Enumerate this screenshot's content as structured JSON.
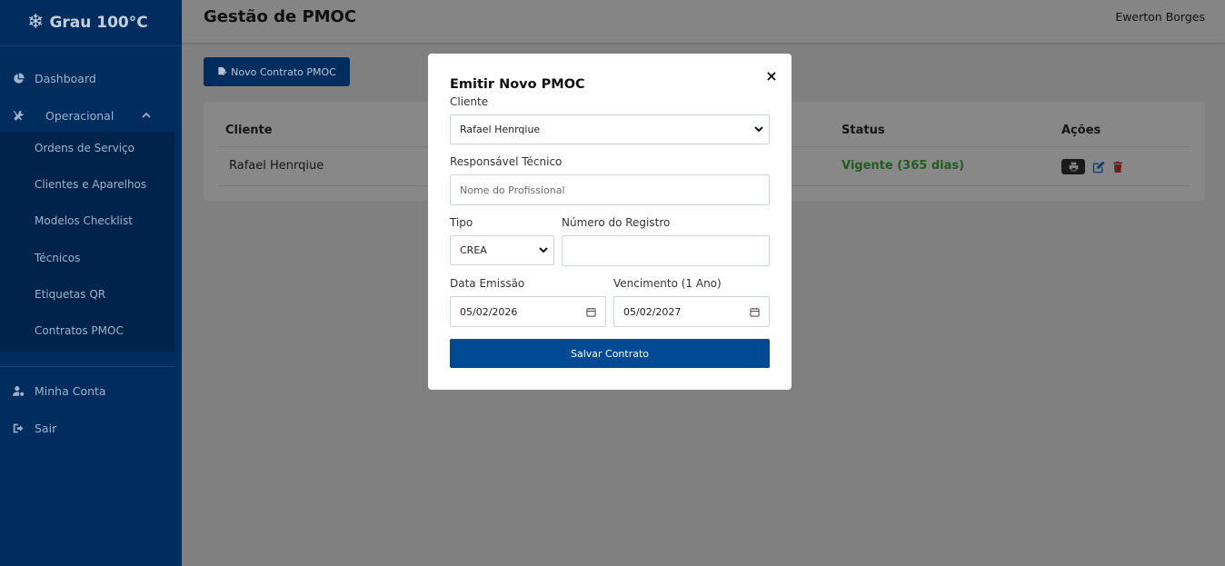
{
  "app": {
    "brand": "Grau 100°C"
  },
  "header": {
    "title": "Gestão de PMOC",
    "user": "Ewerton Borges"
  },
  "sidebar": {
    "items": [
      {
        "label": "Dashboard",
        "icon": "chart-pie-icon"
      },
      {
        "label": "Operacional",
        "icon": "tools-icon"
      },
      {
        "label": "Minha Conta",
        "icon": "user-cog-icon"
      },
      {
        "label": "Sair",
        "icon": "sign-out-icon"
      }
    ],
    "submenu": [
      "Ordens de Serviço",
      "Clientes e Aparelhos",
      "Modelos Checklist",
      "Técnicos",
      "Etiquetas QR",
      "Contratos PMOC"
    ]
  },
  "main": {
    "new_button": "Novo Contrato PMOC",
    "table": {
      "headers": {
        "cliente": "Cliente",
        "status": "Status",
        "acoes": "Ações"
      },
      "rows": [
        {
          "cliente": "Rafael Henrqiue",
          "status": "Vigente (365 dias)"
        }
      ]
    }
  },
  "modal": {
    "title": "Emitir Novo PMOC",
    "close": "×",
    "cliente_label": "Cliente",
    "cliente_value": "Rafael Henrqiue",
    "responsavel_label": "Responsável Técnico",
    "responsavel_placeholder": "Nome do Profissional",
    "tipo_label": "Tipo",
    "tipo_value": "CREA",
    "registro_label": "Número do Registro",
    "registro_value": "",
    "emissao_label": "Data Emissão",
    "emissao_value": "05/02/2026",
    "vencimento_label": "Vencimento (1 Ano)",
    "vencimento_value": "05/02/2027",
    "save_label": "Salvar Contrato"
  },
  "colors": {
    "sidebar": "#002c5e",
    "primary": "#004a94",
    "status_ok": "#1f5e1f",
    "danger": "#6d1a20"
  }
}
